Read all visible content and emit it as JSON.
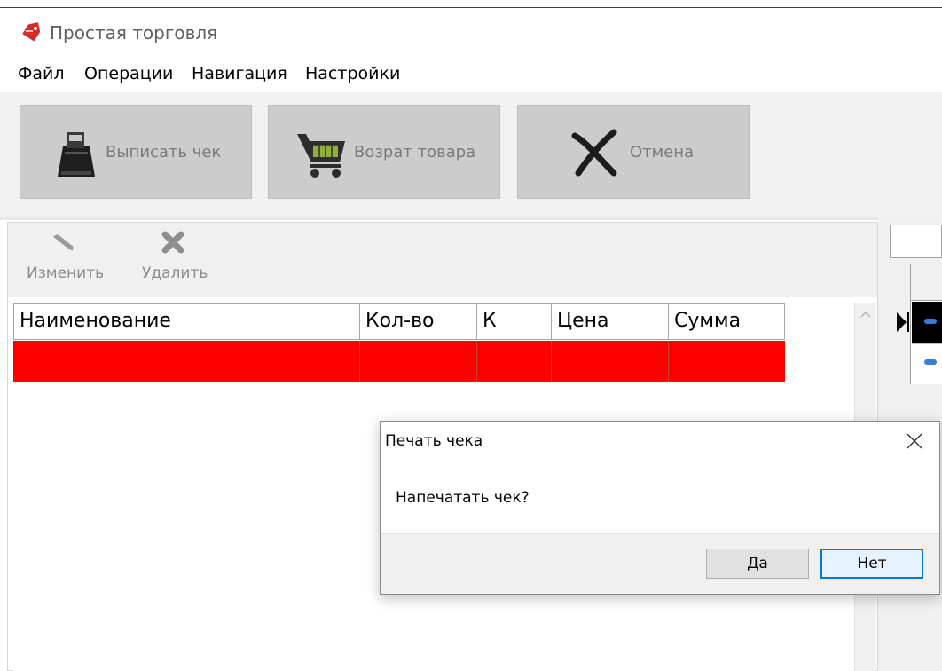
{
  "window": {
    "title": "Простая торговля"
  },
  "menu": [
    "Файл",
    "Операции",
    "Навигация",
    "Настройки"
  ],
  "toolbar": {
    "buttons": [
      {
        "label": "Выписать чек",
        "icon": "cash-register-icon"
      },
      {
        "label": "Возрат товара",
        "icon": "shopping-cart-icon"
      },
      {
        "label": "Отмена",
        "icon": "cancel-x-icon"
      }
    ]
  },
  "subtoolbar": {
    "edit_label": "Изменить",
    "delete_label": "Удалить"
  },
  "table": {
    "columns": [
      "Наименование",
      "Кол-во",
      "К",
      "Цена",
      "Сумма"
    ],
    "rows": [
      [
        "",
        "",
        "",
        "",
        ""
      ]
    ],
    "selected_row_color": "#ff0000"
  },
  "dialog": {
    "title": "Печать чека",
    "message": "Напечатать чек?",
    "yes_label": "Да",
    "no_label": "Нет",
    "default_button_color": "#0078d7"
  }
}
